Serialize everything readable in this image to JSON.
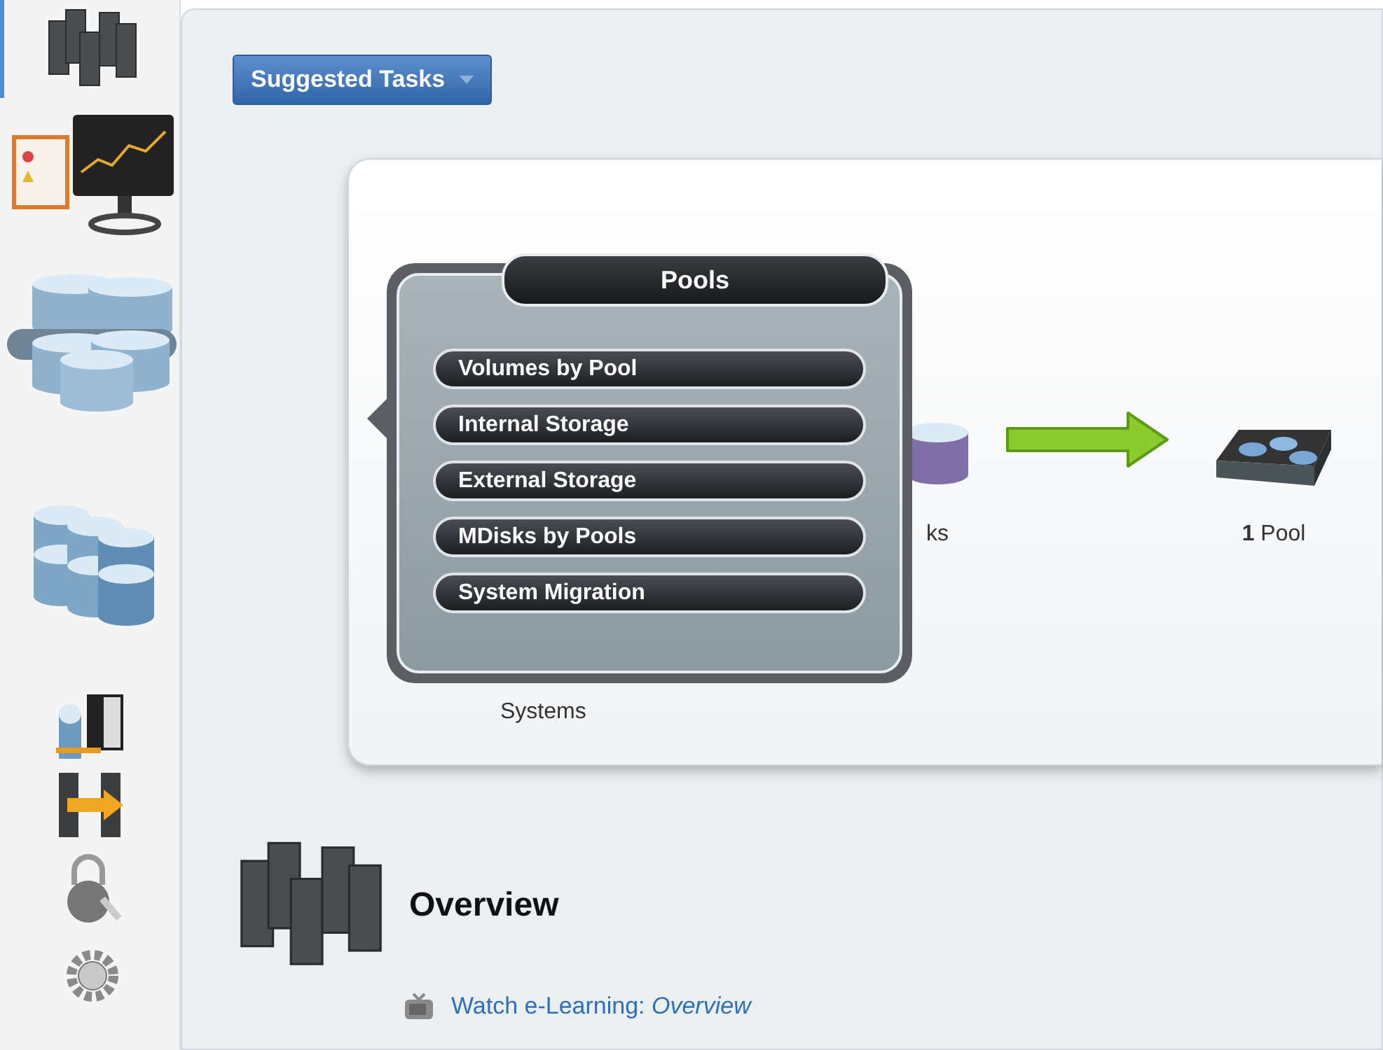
{
  "sidebar": {
    "items": [
      {
        "kind": "servers",
        "selected": true
      },
      {
        "kind": "monitor",
        "selected": false
      },
      {
        "kind": "pools",
        "selected": false
      },
      {
        "kind": "volumes",
        "selected": false
      },
      {
        "kind": "hosts",
        "selected": false
      },
      {
        "kind": "copy",
        "selected": false
      },
      {
        "kind": "access",
        "selected": false
      },
      {
        "kind": "settings",
        "selected": false
      }
    ]
  },
  "suggested_tasks": {
    "label": "Suggested Tasks"
  },
  "diagram": {
    "nodes": [
      {
        "kind": "systems",
        "label": "Systems"
      },
      {
        "kind": "disks",
        "label": "ks"
      },
      {
        "kind": "pool",
        "label": "**1** Pool"
      }
    ]
  },
  "menu": {
    "title": "Pools",
    "items": [
      {
        "label": "Volumes by Pool"
      },
      {
        "label": "Internal Storage"
      },
      {
        "label": "External Storage"
      },
      {
        "label": "MDisks by Pools"
      },
      {
        "label": "System Migration"
      }
    ]
  },
  "overview": {
    "title": "Overview",
    "link": "Watch e-Learning: *Overview*"
  }
}
